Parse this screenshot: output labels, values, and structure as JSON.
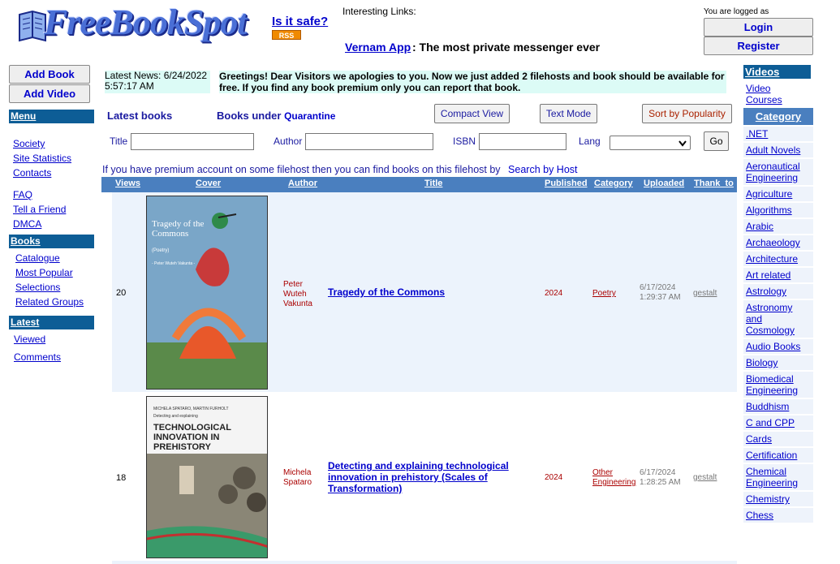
{
  "header": {
    "logo_text": "FreeBookSpot",
    "safe_link": "Is it safe?",
    "rss": "RSS",
    "interesting_links": "Interesting Links:",
    "vernam_link": "Vernam App",
    "vernam_desc": ": The most private messenger ever",
    "logged_in": "You are logged as",
    "login": "Login",
    "register": "Register"
  },
  "left": {
    "add_book": "Add Book",
    "add_video": "Add Video",
    "menu_head": "Menu",
    "menu_items": [
      "Society",
      "Site Statistics",
      "Contacts",
      "FAQ",
      "Tell a Friend",
      "DMCA"
    ],
    "books_head": "Books",
    "books_items": [
      "Catalogue",
      "Most Popular",
      "Selections",
      "Related Groups"
    ],
    "latest_head": "Latest",
    "latest_items": [
      "Viewed",
      "Comments"
    ]
  },
  "news": {
    "date_label": "Latest News: 6/24/2022 5:57:17 AM",
    "text": "Greetings! Dear Visitors we apologies to you. Now we just added 2 filehosts and book should be available for free. If you find any book premium only you can report that book."
  },
  "toolbar": {
    "latest_books": "Latest books",
    "under_label": "Books under",
    "quarantine": "Quarantine",
    "compact_view": "Compact View",
    "text_mode": "Text Mode",
    "sort_popularity": "Sort by Popularity"
  },
  "search": {
    "title_label": "Title",
    "author_label": "Author",
    "isbn_label": "ISBN",
    "lang_label": "Lang",
    "go": "Go"
  },
  "premium_note": "If you have premium account on some filehost then you can find books on this filehost by",
  "search_by_host": "Search by Host",
  "table": {
    "headers": [
      "Views",
      "Cover",
      "Author",
      "Title",
      "Published",
      "Category",
      "Uploaded",
      "Thank_to"
    ],
    "rows": [
      {
        "views": "20",
        "author": "Peter Wuteh Vakunta",
        "title": "Tragedy of the Commons",
        "published": "2024",
        "category": "Poetry",
        "uploaded": "6/17/2024 1:29:37 AM",
        "thank_to": "gestalt",
        "cover_title": "Tragedy of the Commons",
        "cover_sub": "(Poetry)",
        "cover_author": "- Peter Wuteh Vakunta -"
      },
      {
        "views": "18",
        "author": "Michela Spataro",
        "title": "Detecting and explaining technological innovation in prehistory (Scales of Transformation)",
        "published": "2024",
        "category": "Other Engineering",
        "uploaded": "6/17/2024 1:28:25 AM",
        "thank_to": "gestalt",
        "cover_authors": "MICHELA SPATARO, MARTIN FURHOLT",
        "cover_kicker": "Detecting and explaining",
        "cover_title": "TECHNOLOGICAL INNOVATION IN PREHISTORY"
      }
    ]
  },
  "right": {
    "videos_head": "Videos",
    "video_courses": "Video Courses",
    "category_head": "Category",
    "categories": [
      ".NET",
      "Adult Novels",
      "Aeronautical Engineering",
      "Agriculture",
      "Algorithms",
      "Arabic",
      "Archaeology",
      "Architecture",
      "Art related",
      "Astrology",
      "Astronomy and Cosmology",
      "Audio Books",
      "Biology",
      "Biomedical Engineering",
      "Buddhism",
      "C and CPP",
      "Cards",
      "Certification",
      "Chemical Engineering",
      "Chemistry",
      "Chess"
    ]
  },
  "colors": {
    "side_head": "#0d5d96",
    "table_head": "#4a7fbf",
    "news_bg": "#dcfbf6",
    "link": "#0000cc",
    "accent_red": "#aa0000"
  }
}
